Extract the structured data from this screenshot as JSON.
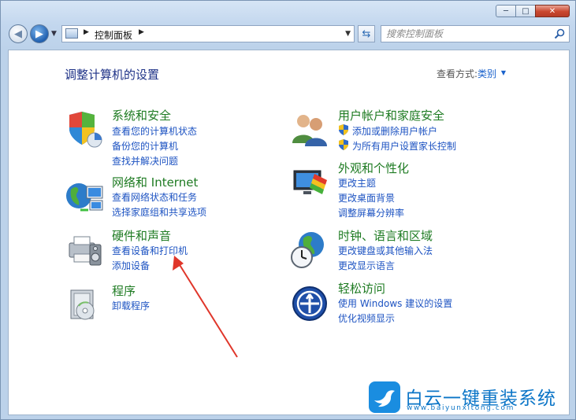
{
  "window": {
    "buttons": {
      "minimize": "─",
      "maximize": "□",
      "close": "✕"
    }
  },
  "toolbar": {
    "address_path": "控制面板",
    "search_placeholder": "搜索控制面板"
  },
  "page": {
    "title": "调整计算机的设置",
    "view_by_label": "查看方式:",
    "view_by_value": "类别"
  },
  "categories": {
    "system": {
      "title": "系统和安全",
      "links": [
        "查看您的计算机状态",
        "备份您的计算机",
        "查找并解决问题"
      ]
    },
    "network": {
      "title": "网络和 Internet",
      "links": [
        "查看网络状态和任务",
        "选择家庭组和共享选项"
      ]
    },
    "hardware": {
      "title": "硬件和声音",
      "links": [
        "查看设备和打印机",
        "添加设备"
      ]
    },
    "programs": {
      "title": "程序",
      "links": [
        "卸载程序"
      ]
    },
    "users": {
      "title": "用户帐户和家庭安全",
      "links": [
        "添加或删除用户帐户",
        "为所有用户设置家长控制"
      ]
    },
    "appearance": {
      "title": "外观和个性化",
      "links": [
        "更改主题",
        "更改桌面背景",
        "调整屏幕分辨率"
      ]
    },
    "clock": {
      "title": "时钟、语言和区域",
      "links": [
        "更改键盘或其他输入法",
        "更改显示语言"
      ]
    },
    "ease": {
      "title": "轻松访问",
      "links": [
        "使用 Windows 建议的设置",
        "优化视频显示"
      ]
    }
  },
  "watermark": {
    "title": "白云一键重装系统",
    "url": "www.baiyunxitong.com"
  },
  "colors": {
    "link": "#1d53c2",
    "category_title": "#1e7b22",
    "page_title": "#1e3287",
    "arrow": "#e0362a"
  }
}
